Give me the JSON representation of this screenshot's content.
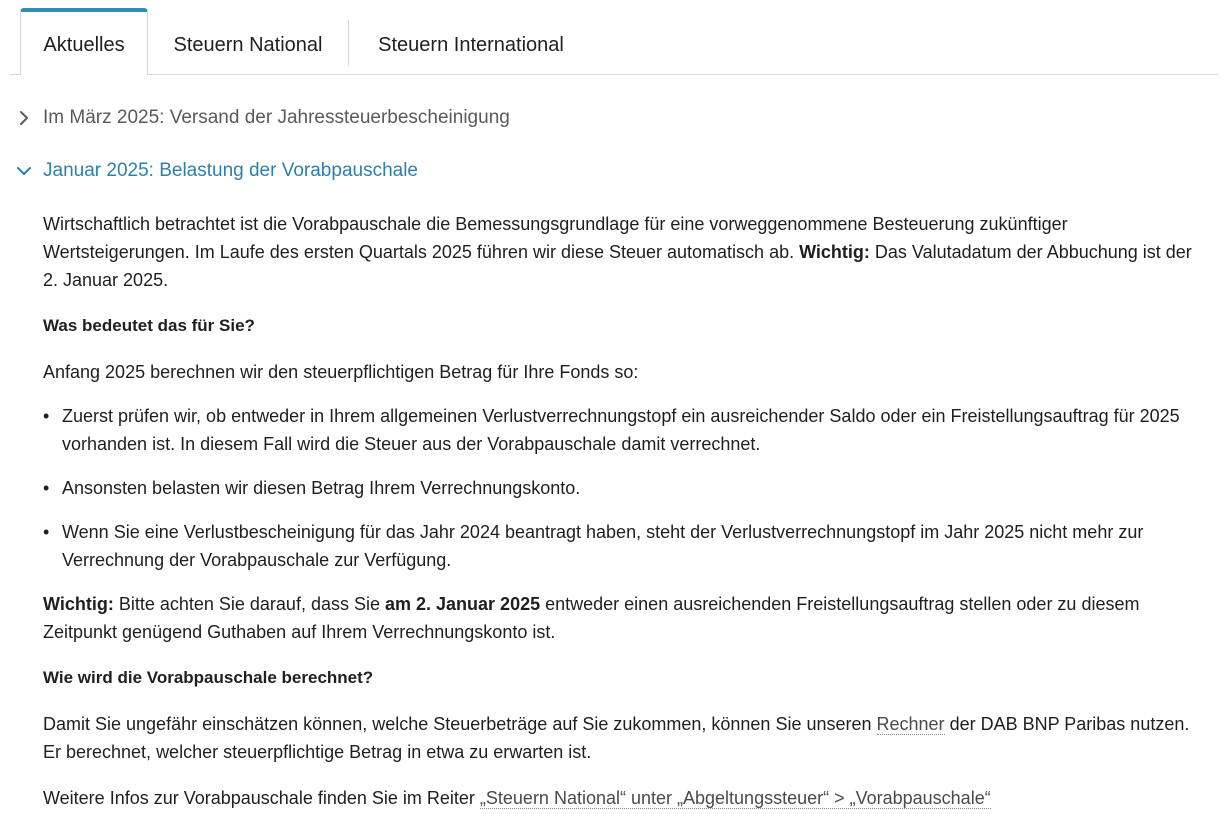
{
  "tabs": [
    {
      "label": "Aktuelles"
    },
    {
      "label": "Steuern National"
    },
    {
      "label": "Steuern International"
    }
  ],
  "accordion": {
    "item1": {
      "title": "Im März 2025: Versand der Jahressteuerbescheinigung",
      "state": "collapsed"
    },
    "item2": {
      "title": "Januar 2025: Belastung der Vorabpauschale",
      "state": "expanded"
    }
  },
  "content": {
    "p1_a": "Wirtschaftlich betrachtet ist die Vorabpauschale die Bemessungsgrundlage für eine vorweggenommene Besteuerung zukünftiger Wertsteigerungen. Im Laufe des ersten Quartals 2025 führen wir diese Steuer automatisch ab. ",
    "p1_bold": "Wichtig:",
    "p1_b": " Das Valutadatum der Abbuchung ist der 2. Januar 2025.",
    "heading1": "Was bedeutet das für Sie?",
    "p2": "Anfang 2025 berechnen wir den steuerpflichtigen Betrag für Ihre Fonds so:",
    "bullet_symbol": "•",
    "bullets": [
      "Zuerst prüfen wir, ob entweder in Ihrem allgemeinen Verlustverrechnungstopf ein ausreichender Saldo oder ein Freistellungsauftrag für 2025 vorhanden ist. In diesem Fall wird die Steuer aus der Vorabpauschale damit verrechnet.",
      "Ansonsten belasten wir diesen Betrag Ihrem Verrechnungskonto.",
      "Wenn Sie eine Verlustbescheinigung für das Jahr 2024 beantragt haben, steht der Verlustverrechnungstopf im Jahr 2025 nicht mehr zur Verrechnung der Vorabpauschale zur Verfügung."
    ],
    "p3_bold1": "Wichtig:",
    "p3_a": " Bitte achten Sie darauf, dass Sie ",
    "p3_bold2": "am 2. Januar 2025",
    "p3_b": " entweder einen ausreichenden Freistellungsauftrag stellen oder zu diesem Zeitpunkt genügend Guthaben auf Ihrem Verrechnungskonto ist.",
    "heading2": "Wie wird die Vorabpauschale berechnet?",
    "p4_a": "Damit Sie ungefähr einschätzen können, welche Steuerbeträge auf Sie zukommen, können Sie unseren ",
    "p4_link": "Rechner",
    "p4_b": " der DAB BNP Paribas nutzen. Er berechnet, welcher steuerpflichtige Betrag in etwa zu erwarten ist.",
    "p5_a": "Weitere Infos zur Vorabpauschale finden Sie im Reiter ",
    "p5_link": "„Steuern National“ unter „Abgeltungssteuer“ > „Vorabpauschale“"
  },
  "colors": {
    "accent": "#2f8bb8",
    "expanded_title": "#2f7fab",
    "text": "#1f1f1f",
    "collapsed_title": "#5a5a5a"
  },
  "icons": {
    "collapsed": "chevron-right-icon",
    "expanded": "chevron-down-icon"
  }
}
